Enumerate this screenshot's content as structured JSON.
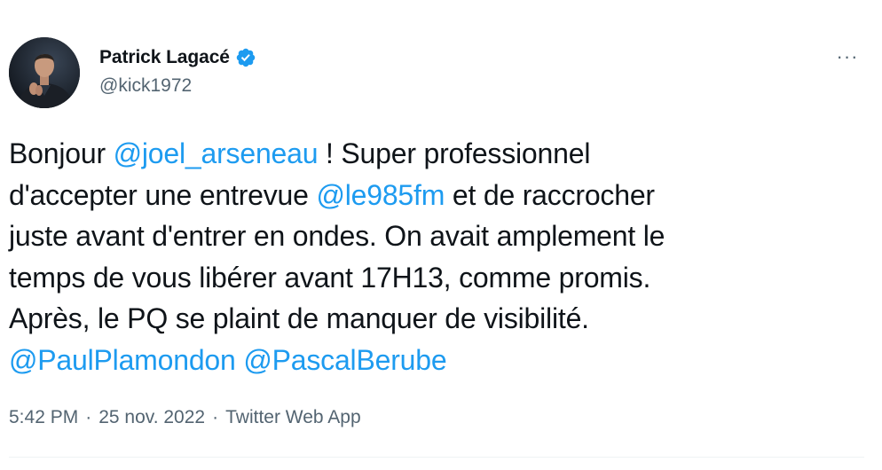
{
  "author": {
    "display_name": "Patrick Lagacé",
    "handle": "@kick1972",
    "verified": true
  },
  "tweet": {
    "lines": [
      [
        {
          "t": "Bonjour ",
          "m": false
        },
        {
          "t": "@joel_arseneau",
          "m": true
        },
        {
          "t": " ! Super professionnel",
          "m": false
        }
      ],
      [
        {
          "t": "d'accepter une entrevue ",
          "m": false
        },
        {
          "t": "@le985fm",
          "m": true
        },
        {
          "t": " et de raccrocher",
          "m": false
        }
      ],
      [
        {
          "t": "juste avant d'entrer en ondes. On avait amplement le",
          "m": false
        }
      ],
      [
        {
          "t": "temps de vous libérer avant 17H13, comme promis.",
          "m": false
        }
      ],
      [
        {
          "t": "Après, le PQ se plaint de manquer de visibilité.",
          "m": false
        }
      ],
      [
        {
          "t": "@PaulPlamondon",
          "m": true
        },
        {
          "t": " ",
          "m": false
        },
        {
          "t": "@PascalBerube",
          "m": true
        }
      ]
    ]
  },
  "meta": {
    "time": "5:42 PM",
    "separator": "·",
    "date": "25 nov. 2022",
    "source": "Twitter Web App"
  },
  "menu": {
    "more_label": "···"
  },
  "colors": {
    "accent": "#1d9bf0",
    "text": "#0f1419",
    "secondary": "#536471"
  },
  "icons": {
    "verified": "verified-badge-icon",
    "more": "more-options-icon"
  }
}
